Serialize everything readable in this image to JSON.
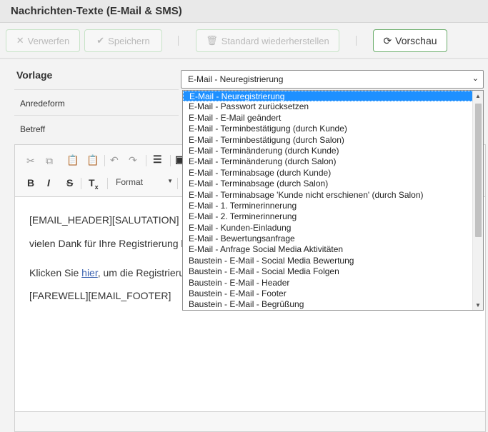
{
  "window": {
    "title": "Nachrichten-Texte (E-Mail & SMS)"
  },
  "toolbar": {
    "discard_label": "Verwerfen",
    "save_label": "Speichern",
    "restore_label": "Standard wiederherstellen",
    "preview_label": "Vorschau"
  },
  "form": {
    "template_label": "Vorlage",
    "template_value": "E-Mail - Neuregistrierung",
    "salutation_label": "Anredeform",
    "subject_label": "Betreff"
  },
  "editor": {
    "format_label": "Format",
    "line1": "[EMAIL_HEADER][SALUTATION]",
    "line2": "vielen Dank für Ihre Registrierung be",
    "line3_prefix": "Klicken Sie ",
    "line3_link": "hier",
    "line3_suffix": ", um die Registrierung",
    "line4": "[FAREWELL][EMAIL_FOOTER]"
  },
  "dropdown": {
    "options": [
      "E-Mail - Neuregistrierung",
      "E-Mail - Passwort zurücksetzen",
      "E-Mail - E-Mail geändert",
      "E-Mail - Terminbestätigung (durch Kunde)",
      "E-Mail - Terminbestätigung (durch Salon)",
      "E-Mail - Terminänderung (durch Kunde)",
      "E-Mail - Terminänderung (durch Salon)",
      "E-Mail - Terminabsage (durch Kunde)",
      "E-Mail - Terminabsage (durch Salon)",
      "E-Mail - Terminabsage 'Kunde nicht erschienen' (durch Salon)",
      "E-Mail - 1. Terminerinnerung",
      "E-Mail - 2. Terminerinnerung",
      "E-Mail - Kunden-Einladung",
      "E-Mail - Bewertungsanfrage",
      "E-Mail - Anfrage Social Media Aktivitäten",
      "Baustein - E-Mail - Social Media Bewertung",
      "Baustein - E-Mail - Social Media Folgen",
      "Baustein - E-Mail - Header",
      "Baustein - E-Mail - Footer",
      "Baustein - E-Mail - Begrüßung"
    ],
    "selected_index": 0
  },
  "colors": {
    "accent": "#1e90ff",
    "button_border": "#6cae6c",
    "link": "#3c63b0"
  }
}
